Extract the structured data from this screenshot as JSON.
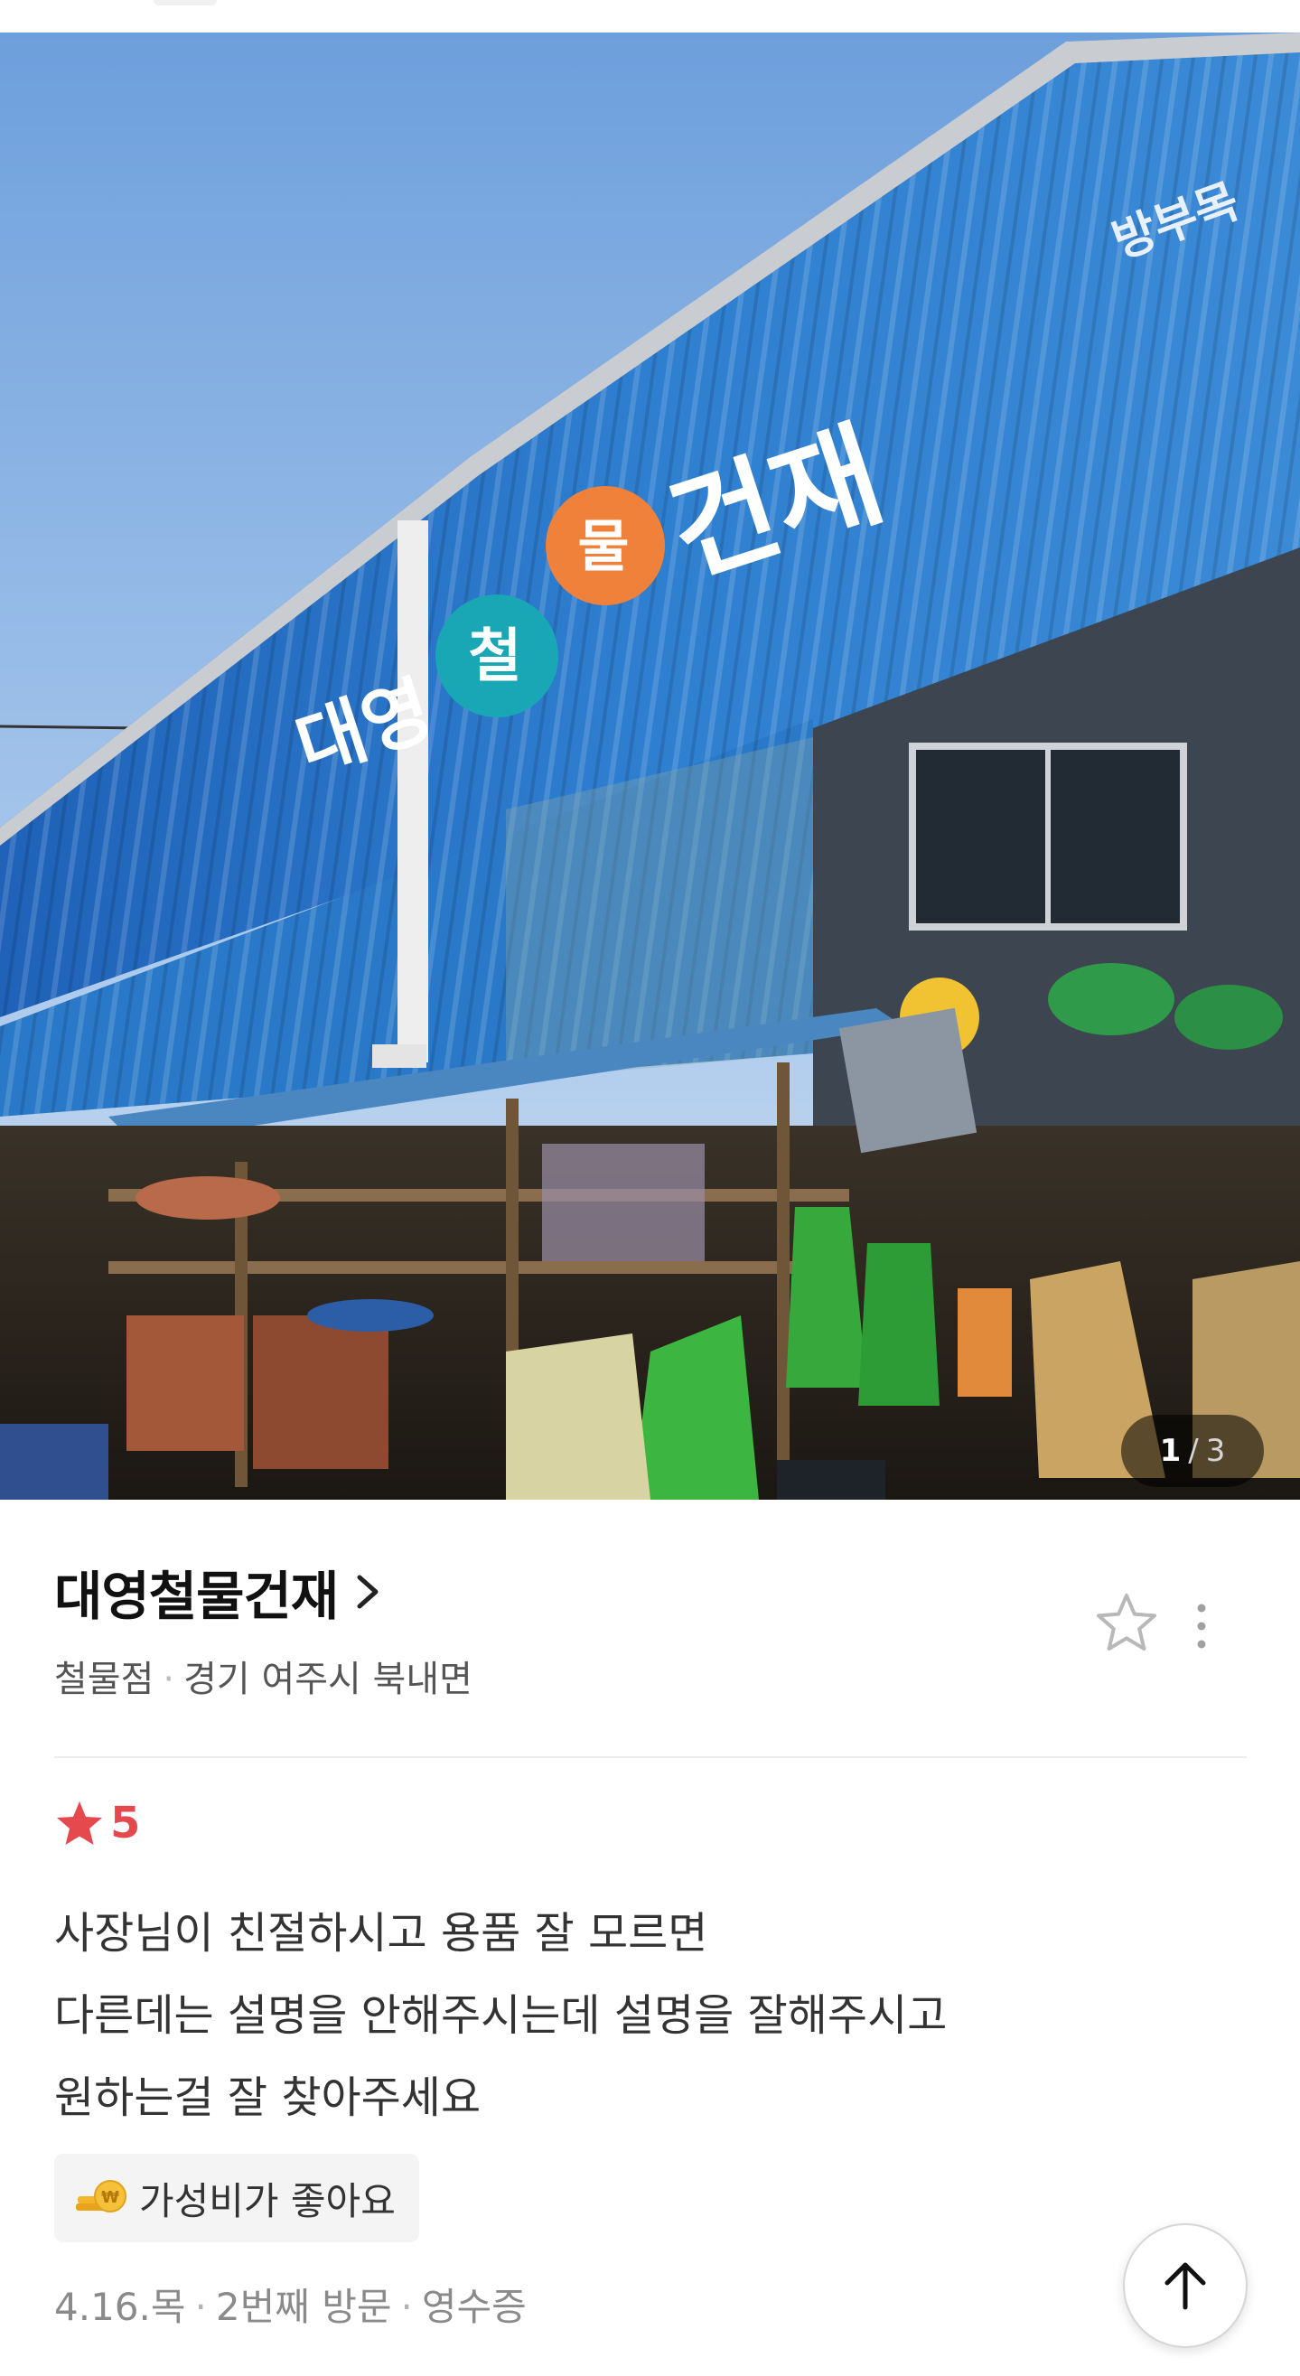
{
  "photo": {
    "counter_current": "1",
    "counter_sep": "/",
    "counter_total": "3",
    "sign_text": "대영철물건재",
    "sign_side": "방부목"
  },
  "place": {
    "name": "대영철물건재",
    "category": "철물점",
    "location": "경기 여주시 북내면",
    "separator": "·"
  },
  "review": {
    "rating": "5",
    "lines": [
      "사장님이 친절하시고 용품 잘 모르면",
      "다른데는 설명을 안해주시는데 설명을 잘해주시고",
      "원하는걸 잘 찾아주세요"
    ],
    "tag": "가성비가 좋아요",
    "date": "4.16.목",
    "visit": "2번째 방문",
    "proof": "영수증"
  },
  "icons": {
    "title_chevron": "chevron-right-icon",
    "favorite": "star-outline-icon",
    "more": "more-vertical-icon",
    "rating_star": "star-filled-icon",
    "tag_icon": "coins-icon",
    "scroll_top": "arrow-up-icon"
  },
  "colors": {
    "rating_red": "#e5484d",
    "shop_blue": "#2f7fd0",
    "gear_teal": "#1aa7b5",
    "gear_orange": "#f0813a"
  }
}
